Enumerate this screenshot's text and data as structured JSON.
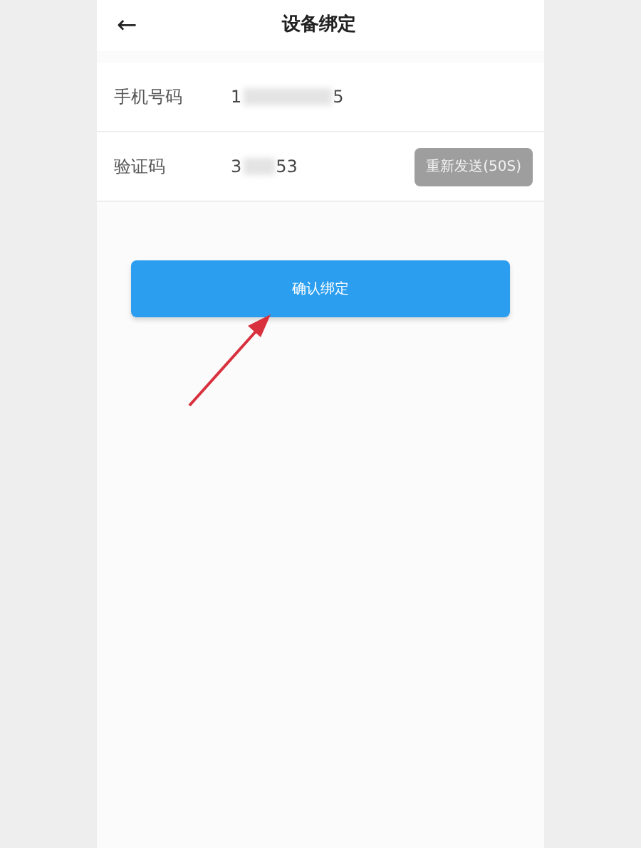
{
  "header": {
    "back": "←",
    "title": "设备绑定"
  },
  "fields": [
    {
      "label": "手机号码",
      "value_start": "1",
      "value_end": "5",
      "masked": true
    },
    {
      "label": "验证码",
      "value_start": "3",
      "value_end": "53",
      "masked": true,
      "button": {
        "label": "重新发送(50S)",
        "disabled": true
      }
    }
  ],
  "confirm_button": {
    "label": "确认绑定"
  },
  "annotation": {
    "kind": "arrow",
    "color": "#d9303e"
  }
}
